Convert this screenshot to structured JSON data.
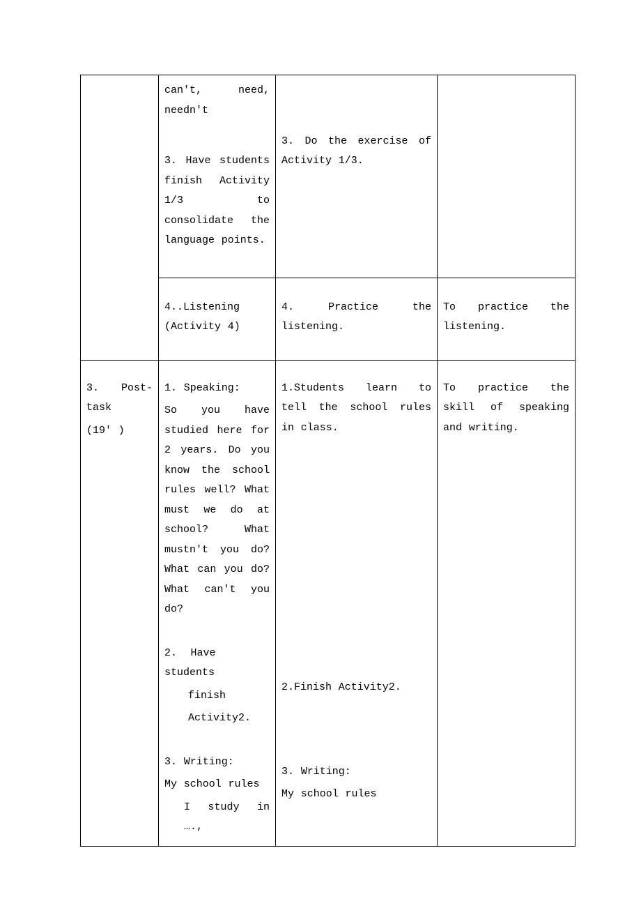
{
  "rows": [
    {
      "col1": "",
      "col2a": "can't, need, needn't",
      "col2b": "3. Have students finish Activity 1/3 to consolidate the language points.",
      "col3a": "",
      "col3b": "3. Do the exercise of Activity 1/3.",
      "col4": ""
    },
    {
      "col1": "",
      "col2": "4..Listening (Activity 4)",
      "col3": "4. Practice the listening.",
      "col4": "To practice the listening."
    },
    {
      "col1a": "3. Post-task",
      "col1b": "(19' )",
      "col2a": "1. Speaking:",
      "col2b": "So you have studied here for 2 years. Do you know the school rules well? What must we do at school? What mustn't you do? What can you do? What can't you do?",
      "col2c": "2. Have students finish Activity2.",
      "col2d": "3. Writing:",
      "col2e": "My school rules",
      "col2f": "I study in ….,",
      "col3a": "1.Students learn to tell the school rules in class.",
      "col3b": "2.Finish Activity2.",
      "col3c": "3. Writing:",
      "col3d": "My school rules",
      "col4": "To practice the skill of speaking and writing."
    }
  ]
}
